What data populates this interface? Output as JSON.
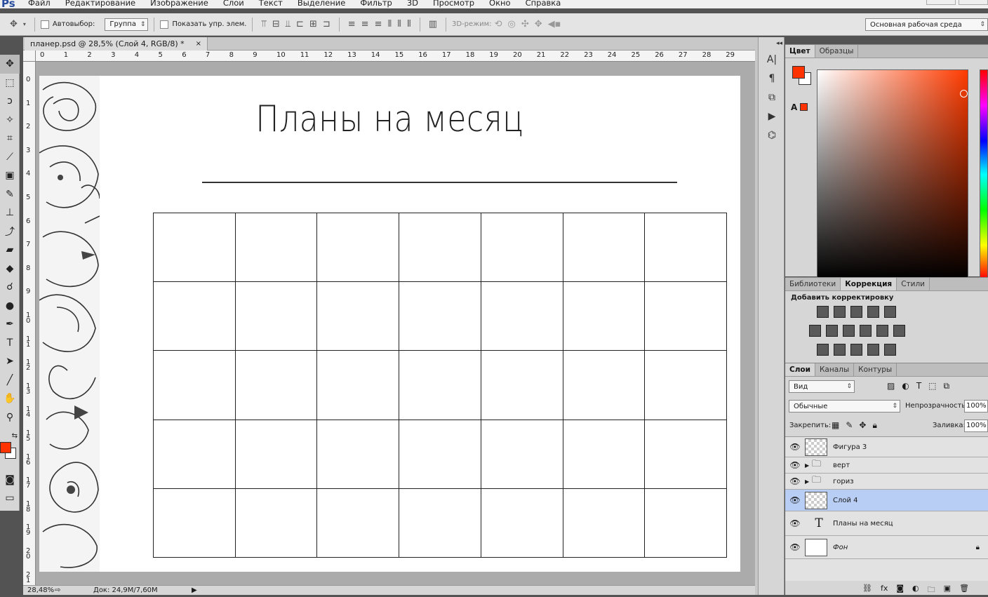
{
  "app": {
    "logo": "Ps"
  },
  "menu": [
    "Файл",
    "Редактирование",
    "Изображение",
    "Слои",
    "Текст",
    "Выделение",
    "Фильтр",
    "3D",
    "Просмотр",
    "Окно",
    "Справка"
  ],
  "options": {
    "autoselect_label": "Автовыбор:",
    "autoselect_value": "Группа",
    "show_controls_label": "Показать упр. элем.",
    "mode_3d_label": "3D-режим:",
    "workspace": "Основная рабочая среда"
  },
  "document": {
    "tab_title": "планер.psd @ 28,5% (Слой 4, RGB/8) *",
    "close": "×",
    "title": "Планы на месяц",
    "grid": {
      "rows": 5,
      "cols": 7
    }
  },
  "rulers": {
    "h_ticks": [
      "0",
      "1",
      "2",
      "3",
      "4",
      "5",
      "6",
      "7",
      "8",
      "9",
      "10",
      "11",
      "12",
      "13",
      "14",
      "15",
      "16",
      "17",
      "18",
      "19",
      "20",
      "21",
      "22",
      "23",
      "24",
      "25",
      "26",
      "27",
      "28",
      "29"
    ],
    "v_ticks": [
      "0",
      "1",
      "2",
      "3",
      "4",
      "5",
      "6",
      "7",
      "8",
      "9",
      "10",
      "11",
      "12",
      "13",
      "14",
      "15",
      "16",
      "17",
      "18",
      "19",
      "20",
      "21"
    ]
  },
  "status": {
    "zoom": "28,48%",
    "doc": "Док: 24,9M/7,60M"
  },
  "colors": {
    "foreground": "#ff3300",
    "background": "#ffffff"
  },
  "color_panel": {
    "tabs": [
      "Цвет",
      "Образцы"
    ]
  },
  "adjust_panel": {
    "tabs": [
      "Библиотеки",
      "Коррекция",
      "Стили"
    ],
    "heading": "Добавить корректировку"
  },
  "layers_panel": {
    "tabs": [
      "Слои",
      "Каналы",
      "Контуры"
    ],
    "filter": "Вид",
    "blend": "Обычные",
    "opacity_label": "Непрозрачность:",
    "opacity": "100%",
    "lock_label": "Закрепить:",
    "fill_label": "Заливка:",
    "fill": "100%",
    "layers": [
      {
        "name": "Фигура 3",
        "kind": "shape"
      },
      {
        "name": "верт",
        "kind": "group"
      },
      {
        "name": "гориз",
        "kind": "group"
      },
      {
        "name": "Слой 4",
        "kind": "pixel",
        "selected": true
      },
      {
        "name": "Планы на месяц",
        "kind": "text"
      },
      {
        "name": "Фон",
        "kind": "background"
      }
    ]
  }
}
